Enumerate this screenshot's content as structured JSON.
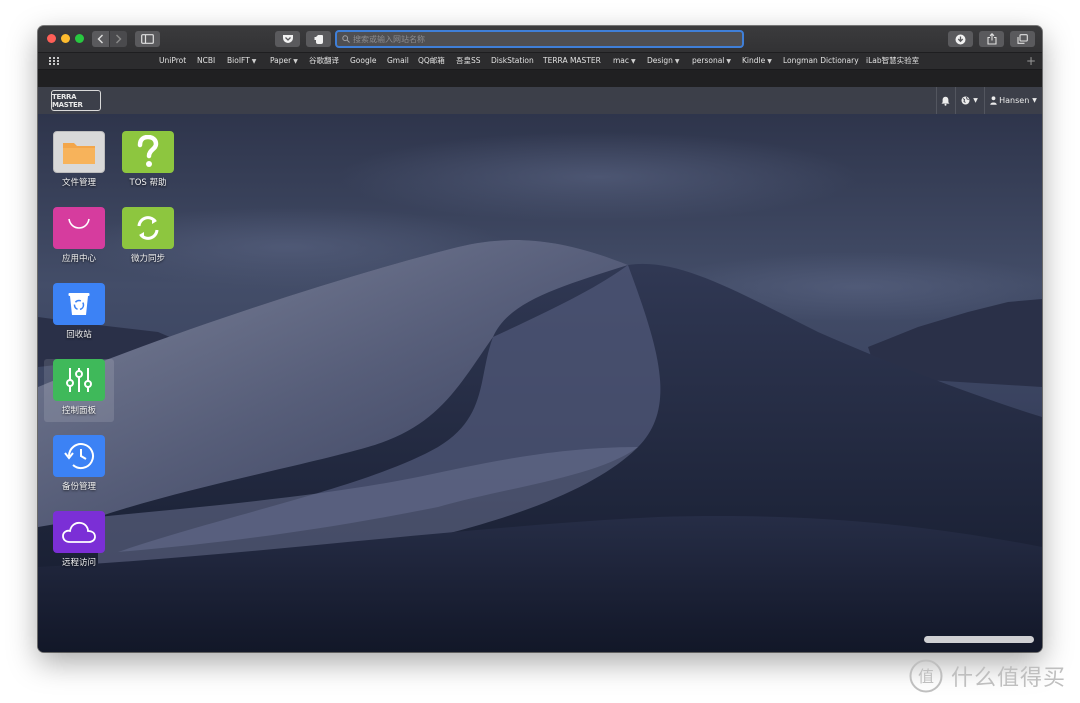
{
  "browser": {
    "address_placeholder": "搜索或输入网站名称",
    "bookmarks": [
      {
        "label": "UniProt",
        "dropdown": false
      },
      {
        "label": "NCBI",
        "dropdown": false
      },
      {
        "label": "BioIFT",
        "dropdown": true
      },
      {
        "label": "Paper",
        "dropdown": true
      },
      {
        "label": "谷歌翻译",
        "dropdown": false
      },
      {
        "label": "Google",
        "dropdown": false
      },
      {
        "label": "Gmail",
        "dropdown": false
      },
      {
        "label": "QQ邮箱",
        "dropdown": false
      },
      {
        "label": "吾皇SS",
        "dropdown": false
      },
      {
        "label": "DiskStation",
        "dropdown": false
      },
      {
        "label": "TERRA MASTER",
        "dropdown": false
      },
      {
        "label": "mac",
        "dropdown": true
      },
      {
        "label": "Design",
        "dropdown": true
      },
      {
        "label": "personal",
        "dropdown": true
      },
      {
        "label": "Kindle",
        "dropdown": true
      },
      {
        "label": "Longman Dictionary",
        "dropdown": false
      },
      {
        "label": "iLab智慧实验室",
        "dropdown": false
      }
    ],
    "add_bookmark_label": "+"
  },
  "nas": {
    "logo_text": "TERRA MASTER",
    "user_name": "Hansen",
    "apps": [
      {
        "label": "文件管理",
        "icon": "folder-icon",
        "color": "#d9d9d9"
      },
      {
        "label": "TOS 帮助",
        "icon": "question-icon",
        "color": "#8dc63f"
      },
      {
        "label": "应用中心",
        "icon": "shopping-bag-icon",
        "color": "#d63c9e"
      },
      {
        "label": "微力同步",
        "icon": "sync-icon",
        "color": "#8dc63f"
      },
      {
        "label": "回收站",
        "icon": "recycle-bin-icon",
        "color": "#3c82f5"
      },
      {
        "label": "控制面板",
        "icon": "sliders-icon",
        "color": "#3fb95a"
      },
      {
        "label": "备份管理",
        "icon": "history-clock-icon",
        "color": "#3c82f5"
      },
      {
        "label": "远程访问",
        "icon": "cloud-icon",
        "color": "#7b2fd6"
      }
    ]
  },
  "watermark": {
    "text": "什么值得买",
    "symbol": "值"
  }
}
